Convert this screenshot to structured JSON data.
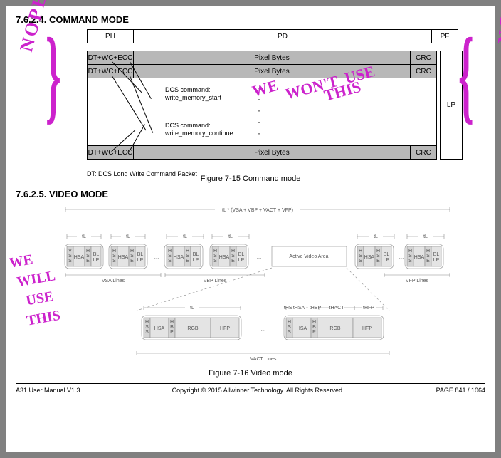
{
  "section_cmd": {
    "num": "7.6.2.4.",
    "title": "COMMAND MODE"
  },
  "section_vid": {
    "num": "7.6.2.5.",
    "title": "VIDEO MODE"
  },
  "cmd_header": {
    "ph": "PH",
    "pd": "PD",
    "pf": "PF"
  },
  "cmd_row": {
    "dt": "DT+WC+ECC",
    "pb": "Pixel Bytes",
    "crc": "CRC"
  },
  "lp": "LP",
  "callout1": {
    "l1": "DCS command:",
    "l2": "write_memory_start"
  },
  "callout2": {
    "l1": "DCS command:",
    "l2": "write_memory_continue"
  },
  "dt_note": "DT: DCS Long Write Command Packet",
  "cmd_caption": "Figure 7-15 Command mode",
  "vid_caption": "Figure 7-16 Video mode",
  "vid": {
    "top": "tL * (VSA + VBP + VACT + VFP)",
    "hss": "HSS",
    "vss": "VSS",
    "hse": "HSE",
    "vse": "VSE",
    "hsa": "HSA",
    "hbp": "HBP",
    "rgb": "RGB",
    "hfp": "HFP",
    "bllp": "BL\nLP",
    "active": "Active Video Area",
    "vsa_lines": "VSA Lines",
    "vbp_lines": "VBP Lines",
    "vfp_lines": "VFP Lines",
    "vact_lines": "VACT Lines",
    "tl": "tL",
    "thsa": "tHSA",
    "thbp": "tHBP",
    "thact": "tHACT",
    "thfp": "tHFP"
  },
  "annot": {
    "nope": "NOPE",
    "wont": [
      "WE",
      "WON'T",
      "USE"
    ],
    "this": "THIS",
    "will": [
      "WE",
      "WILL",
      "USE",
      "THIS"
    ]
  },
  "footer": {
    "left": "A31 User Manual V1.3",
    "mid": "Copyright © 2015 Allwinner Technology. All Rights Reserved.",
    "right": "PAGE 841 / 1064"
  }
}
